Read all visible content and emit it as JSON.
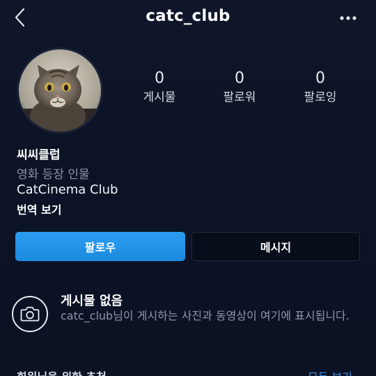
{
  "header": {
    "title": "catc_club",
    "back_icon": "chevron-left-icon",
    "more_icon": "more-horizontal-icon"
  },
  "profile": {
    "avatar_icon": "cat-profile-photo",
    "stats": [
      {
        "value": "0",
        "label": "게시물"
      },
      {
        "value": "0",
        "label": "팔로워"
      },
      {
        "value": "0",
        "label": "팔로잉"
      }
    ],
    "bio": {
      "name": "씨씨클럽",
      "category": "영화 등장 인물",
      "text": "CatCinema Club",
      "translate": "번역 보기"
    }
  },
  "actions": {
    "follow": "팔로우",
    "message": "메시지"
  },
  "empty_state": {
    "icon": "camera-icon",
    "title": "게시물 없음",
    "description": "catc_club님이 게시하는 사진과 동영상이 여기에 표시됩니다."
  },
  "bottom": {
    "left": "회원님을 위한 추천",
    "right": "모두 보기"
  },
  "colors": {
    "background": "#0c1326",
    "accent": "#1b8be0",
    "muted": "#8f97a9"
  }
}
